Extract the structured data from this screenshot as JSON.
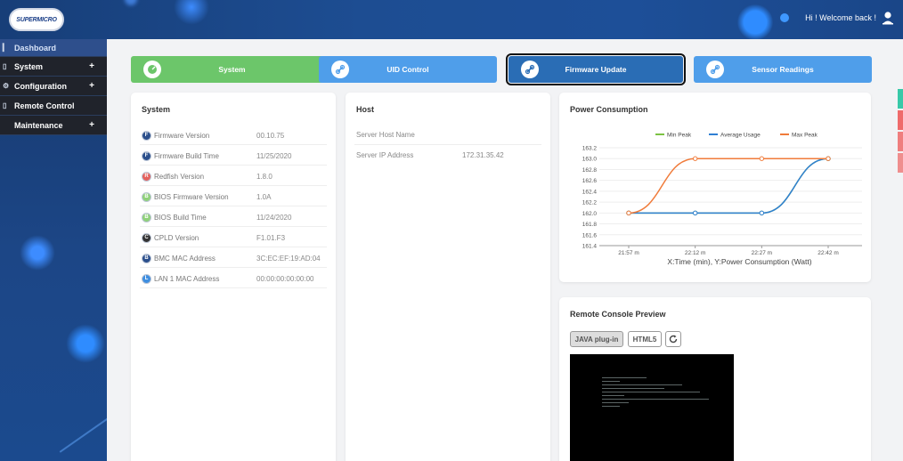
{
  "header": {
    "logo_text": "SUPERMICRO",
    "welcome": "Hi ! Welcome back !"
  },
  "sidebar": {
    "items": [
      {
        "label": "Dashboard",
        "expandable": false
      },
      {
        "label": "System",
        "expandable": true
      },
      {
        "label": "Configuration",
        "expandable": true
      },
      {
        "label": "Remote Control",
        "expandable": false
      },
      {
        "label": "Maintenance",
        "expandable": true
      }
    ],
    "plus": "+"
  },
  "quick_buttons": [
    {
      "label": "System",
      "color": "#6cc66a",
      "icon": "speedometer-icon"
    },
    {
      "label": "UID Control",
      "color": "#4f9eea",
      "icon": "link-icon"
    },
    {
      "label": "Firmware Update",
      "color": "#2a6db5",
      "icon": "link-icon",
      "selected": true
    },
    {
      "label": "Sensor Readings",
      "color": "#4f9eea",
      "icon": "link-icon"
    }
  ],
  "system_card": {
    "title": "System",
    "rows": [
      {
        "label": "Firmware Version",
        "value": "00.10.75",
        "badge_color": "#2b4f8c"
      },
      {
        "label": "Firmware Build Time",
        "value": "11/25/2020",
        "badge_color": "#2b4f8c"
      },
      {
        "label": "Redfish Version",
        "value": "1.8.0",
        "badge_color": "#e4605c"
      },
      {
        "label": "BIOS Firmware Version",
        "value": "1.0A",
        "badge_color": "#8fd17a"
      },
      {
        "label": "BIOS Build Time",
        "value": "11/24/2020",
        "badge_color": "#8fd17a"
      },
      {
        "label": "CPLD Version",
        "value": "F1.01.F3",
        "badge_color": "#333333"
      },
      {
        "label": "BMC MAC Address",
        "value": "3C:EC:EF:19:AD:04",
        "badge_color": "#2b4f8c"
      },
      {
        "label": "LAN 1 MAC Address",
        "value": "00:00:00:00:00:00",
        "badge_color": "#3e8ee0"
      }
    ]
  },
  "host_card": {
    "title": "Host",
    "rows": [
      {
        "label": "Server Host Name",
        "value": ""
      },
      {
        "label": "Server IP Address",
        "value": "172.31.35.42"
      }
    ]
  },
  "power_card": {
    "title": "Power Consumption"
  },
  "chart_data": {
    "type": "line",
    "title": "",
    "xlabel": "X:Time (min), Y:Power Consumption (Watt)",
    "ylabel": "",
    "categories": [
      "21:57 m",
      "22:12 m",
      "22:27 m",
      "22:42 m"
    ],
    "ylim": [
      161.4,
      163.2
    ],
    "yticks": [
      "163.2",
      "163.0",
      "162.8",
      "162.6",
      "162.4",
      "162.2",
      "162.0",
      "161.8",
      "161.6",
      "161.4"
    ],
    "legend_position": "top-right",
    "series": [
      {
        "name": "Min Peak",
        "color": "#7cc243",
        "values": [
          162.0,
          162.0,
          162.0,
          163.0
        ]
      },
      {
        "name": "Average Usage",
        "color": "#2f7fd3",
        "values": [
          162.0,
          162.0,
          162.0,
          163.0
        ]
      },
      {
        "name": "Max Peak",
        "color": "#f07b3a",
        "values": [
          162.0,
          163.0,
          163.0,
          163.0
        ]
      }
    ]
  },
  "console_card": {
    "title": "Remote Console Preview",
    "java_label": "JAVA plug-in",
    "html5_label": "HTML5"
  },
  "colors": {
    "topbar": "#1d4d92",
    "sidebar": "#1c4686",
    "green": "#6cc66a",
    "blue": "#4f9eea",
    "dark_blue": "#2a6db5"
  }
}
